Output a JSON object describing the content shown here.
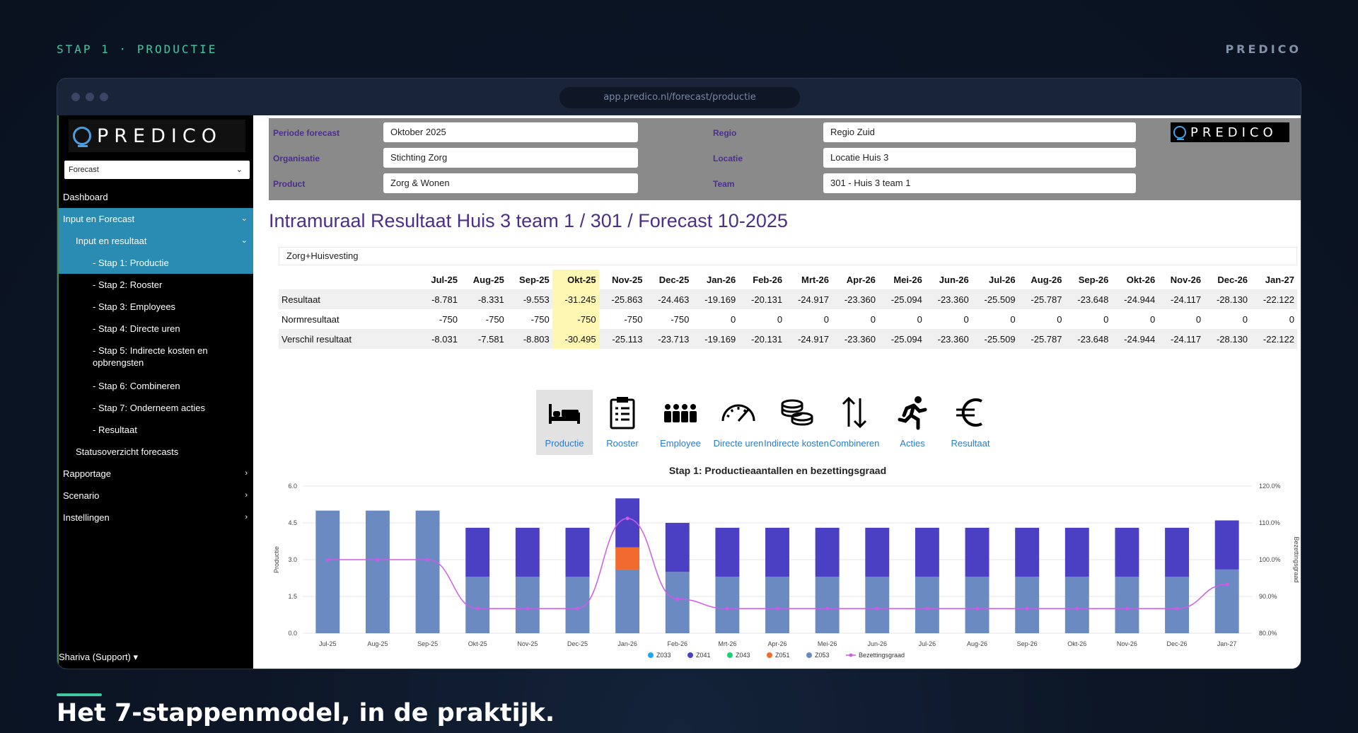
{
  "top": {
    "step": "STAP 1 · PRODUCTIE",
    "brand": "PREDICO"
  },
  "browser": {
    "url": "app.predico.nl/forecast/productie"
  },
  "sidebar": {
    "logo": "PREDICO",
    "select": "Forecast",
    "items": [
      {
        "label": "Dashboard"
      },
      {
        "label": "Input en Forecast"
      },
      {
        "label": "Input en resultaat"
      },
      {
        "label": "- Stap 1: Productie"
      },
      {
        "label": "- Stap 2: Rooster"
      },
      {
        "label": "- Stap 3: Employees"
      },
      {
        "label": "- Stap 4: Directe uren"
      },
      {
        "label": "- Stap 5: Indirecte kosten en opbrengsten"
      },
      {
        "label": "- Stap 6: Combineren"
      },
      {
        "label": "- Stap 7: Onderneem acties"
      },
      {
        "label": "- Resultaat"
      },
      {
        "label": "Statusoverzicht forecasts"
      },
      {
        "label": "Rapportage"
      },
      {
        "label": "Scenario"
      },
      {
        "label": "Instellingen"
      }
    ],
    "user": "Shariva (Support) ▾"
  },
  "filters": {
    "periode_label": "Periode forecast",
    "periode": "Oktober 2025",
    "org_label": "Organisatie",
    "org": "Stichting Zorg",
    "product_label": "Product",
    "product": "Zorg & Wonen",
    "regio_label": "Regio",
    "regio": "Regio Zuid",
    "locatie_label": "Locatie",
    "locatie": "Locatie Huis 3",
    "team_label": "Team",
    "team": "301 - Huis 3 team 1",
    "logo": "PREDICO"
  },
  "title": "Intramuraal Resultaat Huis 3 team 1 / 301 / Forecast 10-2025",
  "zorg": "Zorg+Huisvesting",
  "table": {
    "months": [
      "Jul-25",
      "Aug-25",
      "Sep-25",
      "Okt-25",
      "Nov-25",
      "Dec-25",
      "Jan-26",
      "Feb-26",
      "Mrt-26",
      "Apr-26",
      "Mei-26",
      "Jun-26",
      "Jul-26",
      "Aug-26",
      "Sep-26",
      "Okt-26",
      "Nov-26",
      "Dec-26",
      "Jan-27"
    ],
    "rows": [
      {
        "label": "Resultaat",
        "values": [
          "-8.781",
          "-8.331",
          "-9.553",
          "-31.245",
          "-25.863",
          "-24.463",
          "-19.169",
          "-20.131",
          "-24.917",
          "-23.360",
          "-25.094",
          "-23.360",
          "-25.509",
          "-25.787",
          "-23.648",
          "-24.944",
          "-24.117",
          "-28.130",
          "-22.122"
        ]
      },
      {
        "label": "Normresultaat",
        "values": [
          "-750",
          "-750",
          "-750",
          "-750",
          "-750",
          "-750",
          "0",
          "0",
          "0",
          "0",
          "0",
          "0",
          "0",
          "0",
          "0",
          "0",
          "0",
          "0",
          "0"
        ]
      },
      {
        "label": "Verschil resultaat",
        "values": [
          "-8.031",
          "-7.581",
          "-8.803",
          "-30.495",
          "-25.113",
          "-23.713",
          "-19.169",
          "-20.131",
          "-24.917",
          "-23.360",
          "-25.094",
          "-23.360",
          "-25.509",
          "-25.787",
          "-23.648",
          "-24.944",
          "-24.117",
          "-28.130",
          "-22.122"
        ]
      }
    ]
  },
  "steps": [
    {
      "label": "Productie",
      "icon": "bed-icon"
    },
    {
      "label": "Rooster",
      "icon": "clipboard-icon"
    },
    {
      "label": "Employee",
      "icon": "people-icon"
    },
    {
      "label": "Directe uren",
      "icon": "speedometer-icon"
    },
    {
      "label": "Indirecte kosten",
      "icon": "coins-icon"
    },
    {
      "label": "Combineren",
      "icon": "arrows-updown-icon"
    },
    {
      "label": "Acties",
      "icon": "runner-icon"
    },
    {
      "label": "Resultaat",
      "icon": "euro-icon"
    }
  ],
  "caption": "Het 7-stappenmodel, in de praktijk.",
  "chart_data": {
    "type": "bar",
    "title": "Stap 1: Productieaantallen en bezettingsgraad",
    "ylabel": "Productie",
    "y2label": "Bezettingsgraad",
    "ylim": [
      0,
      6
    ],
    "y2lim": [
      80,
      120
    ],
    "yticks": [
      "0.0",
      "1.5",
      "3.0",
      "4.5",
      "6.0"
    ],
    "y2ticks": [
      "80.0%",
      "90.0%",
      "100.0%",
      "110.0%",
      "120.0%"
    ],
    "categories": [
      "Jul-25",
      "Aug-25",
      "Sep-25",
      "Okt-25",
      "Nov-25",
      "Dec-25",
      "Jan-26",
      "Feb-26",
      "Mrt-26",
      "Apr-26",
      "Mei-26",
      "Jun-26",
      "Jul-26",
      "Aug-26",
      "Sep-26",
      "Okt-26",
      "Nov-26",
      "Dec-26",
      "Jan-27"
    ],
    "series": [
      {
        "name": "Z033",
        "color": "#1ea7f0",
        "values": [
          0,
          0,
          0,
          0,
          0,
          0,
          0,
          0,
          0,
          0,
          0,
          0,
          0,
          0,
          0,
          0,
          0,
          0,
          0
        ]
      },
      {
        "name": "Z041",
        "color": "#4b3fc4",
        "values": [
          0,
          0,
          0,
          2.0,
          2.0,
          2.0,
          2.0,
          2.0,
          2.0,
          2.0,
          2.0,
          2.0,
          2.0,
          2.0,
          2.0,
          2.0,
          2.0,
          2.0,
          2.0
        ]
      },
      {
        "name": "Z043",
        "color": "#1ccf74",
        "values": [
          0,
          0,
          0,
          0,
          0,
          0,
          0,
          0,
          0,
          0,
          0,
          0,
          0,
          0,
          0,
          0,
          0,
          0,
          0
        ]
      },
      {
        "name": "Z051",
        "color": "#f26b2e",
        "values": [
          0,
          0,
          0,
          0,
          0,
          0,
          0.9,
          0,
          0,
          0,
          0,
          0,
          0,
          0,
          0,
          0,
          0,
          0,
          0
        ]
      },
      {
        "name": "Z053",
        "color": "#6c8ac2",
        "values": [
          5.0,
          5.0,
          5.0,
          2.3,
          2.3,
          2.3,
          2.6,
          2.5,
          2.3,
          2.3,
          2.3,
          2.3,
          2.3,
          2.3,
          2.3,
          2.3,
          2.3,
          2.3,
          2.6
        ]
      }
    ],
    "line": {
      "name": "Bezettingsgraad",
      "color": "#d05ae8",
      "values": [
        100,
        100,
        100,
        86.7,
        86.7,
        86.7,
        111.2,
        89.3,
        86.7,
        86.7,
        86.7,
        86.7,
        86.7,
        86.7,
        86.7,
        86.7,
        86.7,
        86.7,
        93.3
      ]
    },
    "stack_totals_override": [
      5.0,
      5.0,
      5.0,
      4.3,
      4.3,
      4.3,
      5.5,
      4.5,
      4.3,
      4.3,
      4.3,
      4.3,
      4.3,
      4.3,
      4.3,
      4.3,
      4.3,
      4.3,
      4.6
    ],
    "legend": "bottom"
  }
}
